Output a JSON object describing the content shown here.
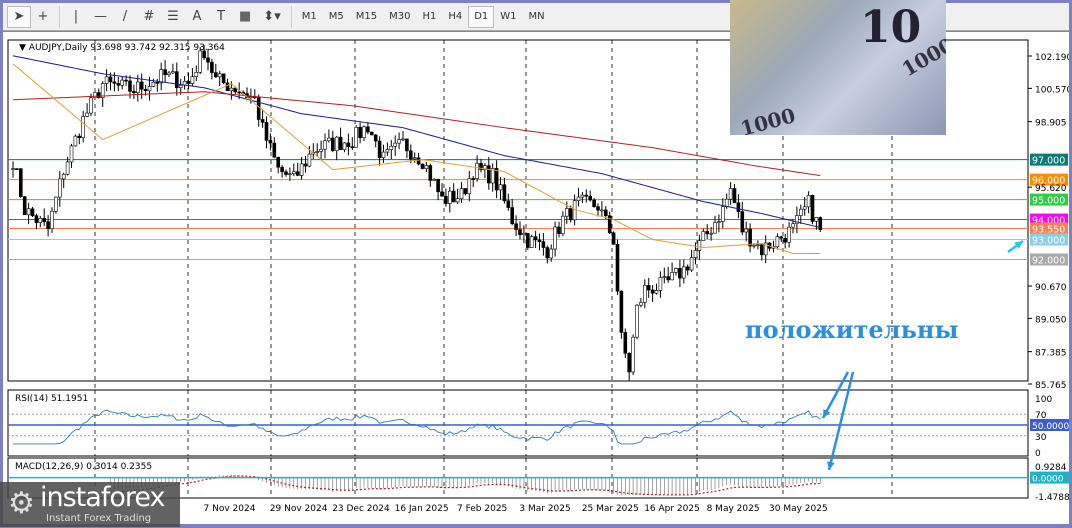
{
  "toolbar": {
    "tools": [
      "cursor-icon",
      "crosshair-icon",
      "vertical-line-icon",
      "horizontal-line-icon",
      "trendline-icon",
      "fibonacci-icon",
      "fibo-levels-icon",
      "text-icon",
      "text-label-icon",
      "rectangle-icon",
      "arrows-icon"
    ],
    "tool_labels": {
      "text": "A",
      "label": "T"
    },
    "timeframes": [
      "M1",
      "M5",
      "M15",
      "M30",
      "H1",
      "H4",
      "D1",
      "W1",
      "MN"
    ],
    "active_timeframe": "D1"
  },
  "header": {
    "symbol": "AUDJPY,Daily",
    "ohlc": "93.698 93.742 92.315 93.364"
  },
  "annotation": "положительны",
  "image_text": {
    "note": "10",
    "yen": "1000"
  },
  "logo": {
    "name": "instaforex",
    "tagline": "Instant Forex Trading"
  },
  "chart_data": {
    "type": "candlestick",
    "title": "AUDJPY,Daily",
    "ylim": [
      85.765,
      102.19
    ],
    "y_ticks": [
      "102.190",
      "100.570",
      "98.905",
      "95.620",
      "90.670",
      "89.050",
      "87.385",
      "85.765"
    ],
    "x_ticks": [
      "7 Nov 2024",
      "29 Nov 2024",
      "23 Dec 2024",
      "16 Jan 2025",
      "7 Feb 2025",
      "3 Mar 2025",
      "25 Mar 2025",
      "16 Apr 2025",
      "8 May 2025",
      "30 May 2025"
    ],
    "x_tick_bars": [
      55,
      72,
      88,
      104,
      120,
      136,
      152,
      168,
      184,
      200
    ],
    "n_bars": 208,
    "close_keypoints": [
      [
        0,
        97
      ],
      [
        3,
        94.5
      ],
      [
        9,
        93.5
      ],
      [
        13,
        96.5
      ],
      [
        18,
        99
      ],
      [
        23,
        100.8
      ],
      [
        31,
        100.5
      ],
      [
        39,
        101.2
      ],
      [
        45,
        100.8
      ],
      [
        49,
        102.5
      ],
      [
        52,
        101
      ],
      [
        58,
        100.5
      ],
      [
        62,
        100
      ],
      [
        64,
        98.5
      ],
      [
        68,
        96.5
      ],
      [
        72,
        96
      ],
      [
        77,
        97.5
      ],
      [
        82,
        97.8
      ],
      [
        87,
        98
      ],
      [
        91,
        98.7
      ],
      [
        95,
        97
      ],
      [
        100,
        97.8
      ],
      [
        105,
        97
      ],
      [
        110,
        95
      ],
      [
        115,
        95.2
      ],
      [
        118,
        96.5
      ],
      [
        123,
        96.2
      ],
      [
        128,
        94
      ],
      [
        132,
        93
      ],
      [
        137,
        92.5
      ],
      [
        141,
        94
      ],
      [
        145,
        94.8
      ],
      [
        150,
        94.7
      ],
      [
        154,
        93
      ],
      [
        156,
        88
      ],
      [
        158,
        86.5
      ],
      [
        160,
        89.5
      ],
      [
        162,
        90.5
      ],
      [
        167,
        90.7
      ],
      [
        172,
        91.5
      ],
      [
        177,
        93
      ],
      [
        182,
        94.5
      ],
      [
        184,
        95.5
      ],
      [
        187,
        93.5
      ],
      [
        192,
        92.5
      ],
      [
        196,
        93
      ],
      [
        200,
        93.5
      ],
      [
        204,
        94.8
      ],
      [
        207,
        93.4
      ]
    ],
    "moving_averages": [
      {
        "name": "MA blue",
        "color": "#1a1a8c",
        "points": [
          [
            0,
            102.2
          ],
          [
            23,
            101.3
          ],
          [
            49,
            100.6
          ],
          [
            74,
            99.3
          ],
          [
            100,
            98.6
          ],
          [
            126,
            97.2
          ],
          [
            151,
            96.3
          ],
          [
            164,
            95.6
          ],
          [
            177,
            94.9
          ],
          [
            192,
            94.3
          ],
          [
            207,
            93.6
          ]
        ]
      },
      {
        "name": "MA red",
        "color": "#b22222",
        "points": [
          [
            0,
            100
          ],
          [
            49,
            100.4
          ],
          [
            87,
            99.7
          ],
          [
            126,
            98.6
          ],
          [
            164,
            97.6
          ],
          [
            190,
            96.7
          ],
          [
            207,
            96.2
          ]
        ]
      },
      {
        "name": "MA orange",
        "color": "#e0a030",
        "points": [
          [
            0,
            101.8
          ],
          [
            23,
            98
          ],
          [
            56,
            100.8
          ],
          [
            82,
            96.5
          ],
          [
            105,
            97
          ],
          [
            126,
            96.4
          ],
          [
            144,
            94.5
          ],
          [
            154,
            94
          ],
          [
            164,
            93
          ],
          [
            177,
            92.6
          ],
          [
            192,
            92.8
          ],
          [
            200,
            92.3
          ],
          [
            207,
            92.3
          ]
        ]
      }
    ],
    "levels": [
      {
        "value": "97.000",
        "price": 97,
        "color": "#0a7a7a"
      },
      {
        "value": "96.000",
        "price": 96,
        "color": "#ff8c00"
      },
      {
        "value": "95.000",
        "price": 95,
        "color": "#2ecc40"
      },
      {
        "value": "94.000",
        "price": 94,
        "color": "#ff00ff"
      },
      {
        "value": "93.550",
        "price": 93.55,
        "color": "#ff7f50"
      },
      {
        "value": "93.000",
        "price": 93,
        "color": "#87ceeb"
      },
      {
        "value": "92.000",
        "price": 92,
        "color": "#a9a9a9"
      }
    ],
    "rsi": {
      "label": "RSI(14) 51.1951",
      "ticks": [
        "100",
        "70",
        "50.0000",
        "30",
        "0"
      ],
      "level_color": "#3a5fcd",
      "line_color": "#2b7bb9"
    },
    "macd": {
      "label": "MACD(12,26,9) 0.3014 0.2355",
      "ticks": [
        "0.9284",
        "0.0000",
        "-1.4788"
      ],
      "range": [
        -1.4788,
        0.9284
      ]
    }
  }
}
